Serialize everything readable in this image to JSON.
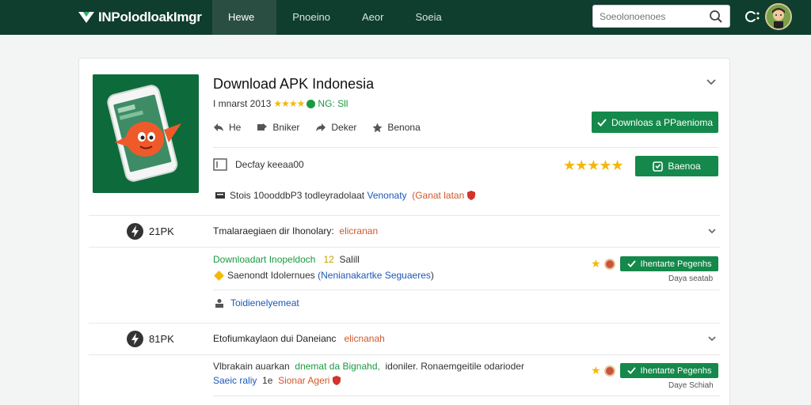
{
  "header": {
    "logo_text": "INPolodloakImgr",
    "nav": [
      {
        "label": "Hewe",
        "active": true
      },
      {
        "label": "Pnoeino",
        "active": false
      },
      {
        "label": "Aeor",
        "active": false
      },
      {
        "label": "Soeia",
        "active": false
      }
    ],
    "search_placeholder": "Soeolonoenoes"
  },
  "app": {
    "title": "Download APK Indonesia",
    "meta_prefix": "I mnarst  2013",
    "meta_rating": "NG: Sll",
    "actions": [
      {
        "icon": "reply-icon",
        "label": "He"
      },
      {
        "icon": "share-icon",
        "label": "Bniker"
      },
      {
        "icon": "forward-icon",
        "label": "Deker"
      },
      {
        "icon": "star-icon",
        "label": "Benona"
      }
    ],
    "download_label": "Downloas a PPaenioma",
    "version_text": "Decfay keeaa00",
    "rate_label": "Baenoa",
    "info_prefix": "Stois 10ooddbP3 todleyradolaat",
    "info_blue": "Venonaty",
    "info_orange": "(Ganat latan"
  },
  "sections": [
    {
      "code": "21PK",
      "title": "Tmalaraegiaen dir Ihonolary:",
      "title_tag": "elicranan",
      "line1_green": "Downloadart Inopeldoch",
      "line1_num": "12",
      "line1_rest": "Salill",
      "line2_prefix": "Saenondt Idolernues",
      "line2_blue": "(Nenianakartke Seguaeres",
      "line2_suffix": ")",
      "button_label": "Ihentarte Pegenhs",
      "days": "Daya seatab",
      "link": "Toidienelyemeat"
    },
    {
      "code": "81PK",
      "title": "Etofiumkaylaon dui Daneianc",
      "title_tag": "elicnanah",
      "line1_prefix": "Vlbrakain auarkan",
      "line1_green": "dnemat da Bignahd,",
      "line1_rest": "idoniler. Ronaemgeitile odarioder",
      "line2_blue": "Saeic raliy",
      "line2_num": "1e",
      "line2_orange": "Sionar Ageri",
      "button_label": "Ihentarte Pegenhs",
      "days": "Daye Schiah"
    }
  ]
}
